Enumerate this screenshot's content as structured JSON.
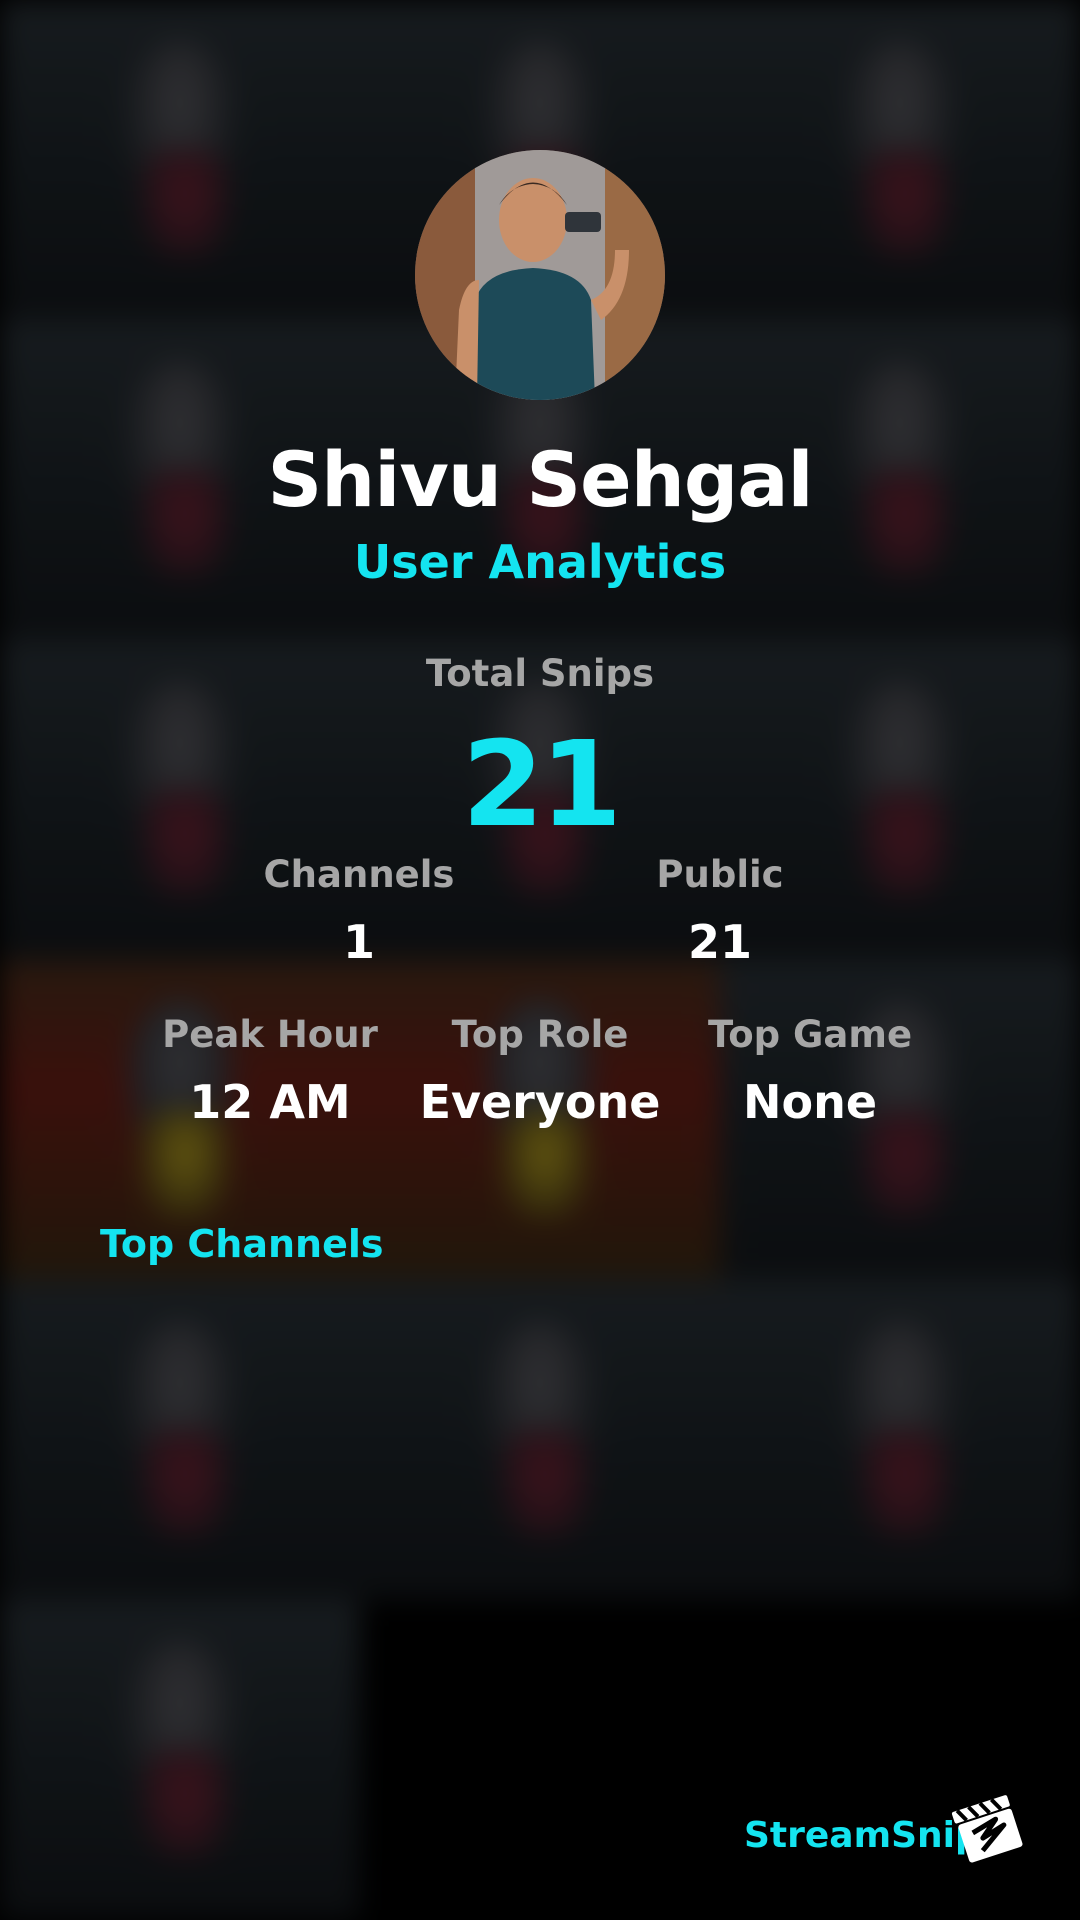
{
  "profile": {
    "name": "Shivu Sehgal",
    "subtitle": "User Analytics"
  },
  "stats": {
    "total_snips": {
      "label": "Total Snips",
      "value": "21"
    },
    "channels": {
      "label": "Channels",
      "value": "1"
    },
    "public": {
      "label": "Public",
      "value": "21"
    },
    "peak_hour": {
      "label": "Peak Hour",
      "value": "12 AM"
    },
    "top_role": {
      "label": "Top Role",
      "value": "Everyone"
    },
    "top_game": {
      "label": "Top Game",
      "value": "None"
    }
  },
  "top_channels": {
    "title": "Top Channels"
  },
  "footer": {
    "brand": "StreamSnip",
    "logo_icon": "clapperboard-icon"
  },
  "colors": {
    "accent": "#14e4f0",
    "label": "#a6a6a6",
    "value": "#ffffff",
    "background": "#000000"
  }
}
